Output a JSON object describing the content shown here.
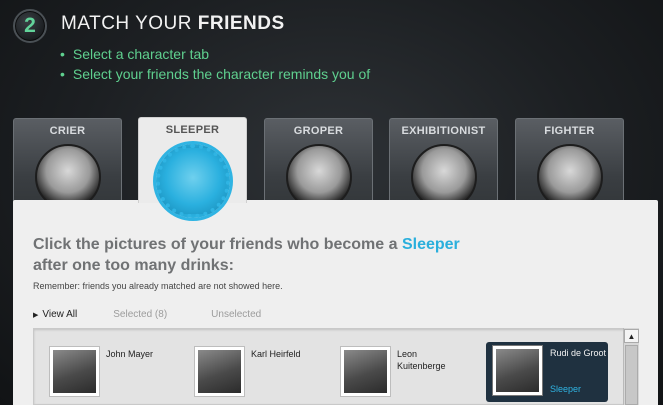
{
  "header": {
    "step_number": "2",
    "title_light": "MATCH YOUR ",
    "title_bold": "FRIENDS",
    "instructions": [
      "Select a character tab",
      "Select your friends the character reminds you of"
    ]
  },
  "tabs": [
    {
      "label": "CRIER",
      "icon": "crying-woman-portrait",
      "active": false
    },
    {
      "label": "SLEEPER",
      "icon": "sleeping-man-portrait",
      "active": true
    },
    {
      "label": "GROPER",
      "icon": "groping-man-portrait",
      "active": false
    },
    {
      "label": "EXHIBITIONIST",
      "icon": "shirtless-man-portrait",
      "active": false
    },
    {
      "label": "FIGHTER",
      "icon": "boxer-portrait",
      "active": false
    }
  ],
  "panel": {
    "heading_before": "Click the pictures of your friends who become a ",
    "heading_character": "Sleeper",
    "heading_after": "after one too many drinks:",
    "note": "Remember: friends you already matched are not showed here.",
    "filters": {
      "view_all": "View All",
      "selected": "Selected (8)",
      "unselected": "Unselected"
    }
  },
  "friends": [
    {
      "name": "John Mayer",
      "selected": false
    },
    {
      "name": "Karl Heirfeld",
      "selected": false
    },
    {
      "name": "Leon Kuitenberge",
      "selected": false
    },
    {
      "name": "Rudi de Groot",
      "selected": true,
      "tag": "Sleeper"
    }
  ],
  "colors": {
    "accent_green": "#5fd08f",
    "accent_blue": "#2aafdc",
    "selected_bg": "#1f3140"
  },
  "scrollbar": {
    "up_icon": "arrow-up-icon"
  }
}
